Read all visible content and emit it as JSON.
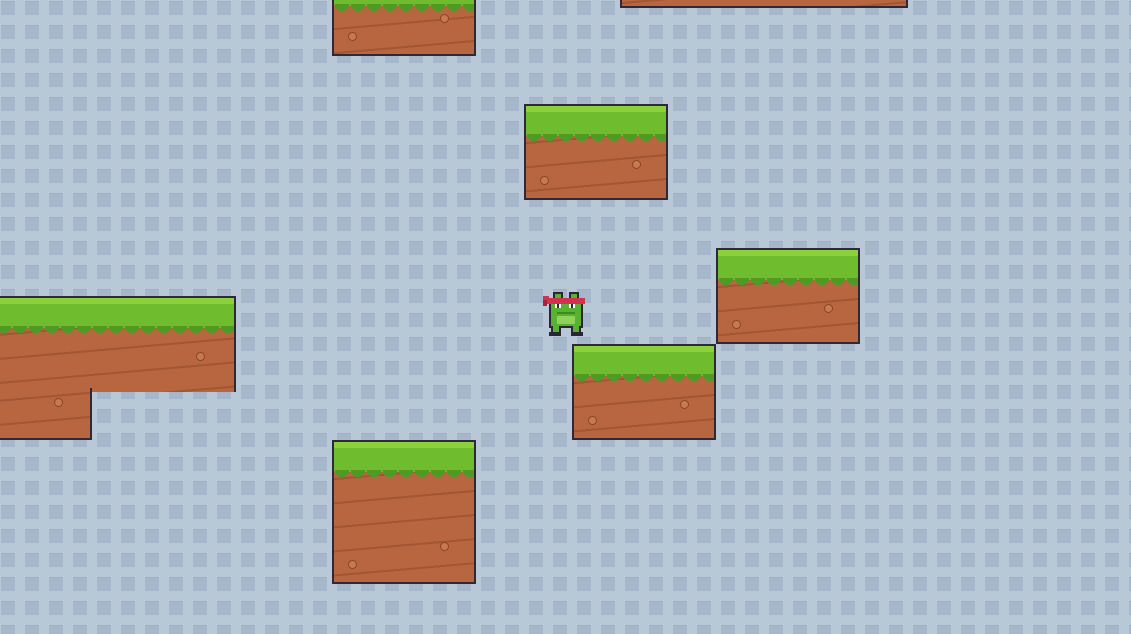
{
  "scene": {
    "type": "platformer-level",
    "background_color": "#b9c8d6",
    "tile_inset_color": "#a5b6cb",
    "grass_color": "#6fbd2f",
    "dirt_color": "#b8663f",
    "outline_color": "#2f2838"
  },
  "player": {
    "character": "ninja-frog",
    "headband_color": "#d3324f",
    "body_color": "#58b12f"
  },
  "platforms": [
    {
      "name": "platform-top-left"
    },
    {
      "name": "platform-top-right"
    },
    {
      "name": "platform-upper-middle"
    },
    {
      "name": "platform-right"
    },
    {
      "name": "platform-left-ledge"
    },
    {
      "name": "platform-under-player"
    },
    {
      "name": "platform-bottom-middle"
    }
  ]
}
